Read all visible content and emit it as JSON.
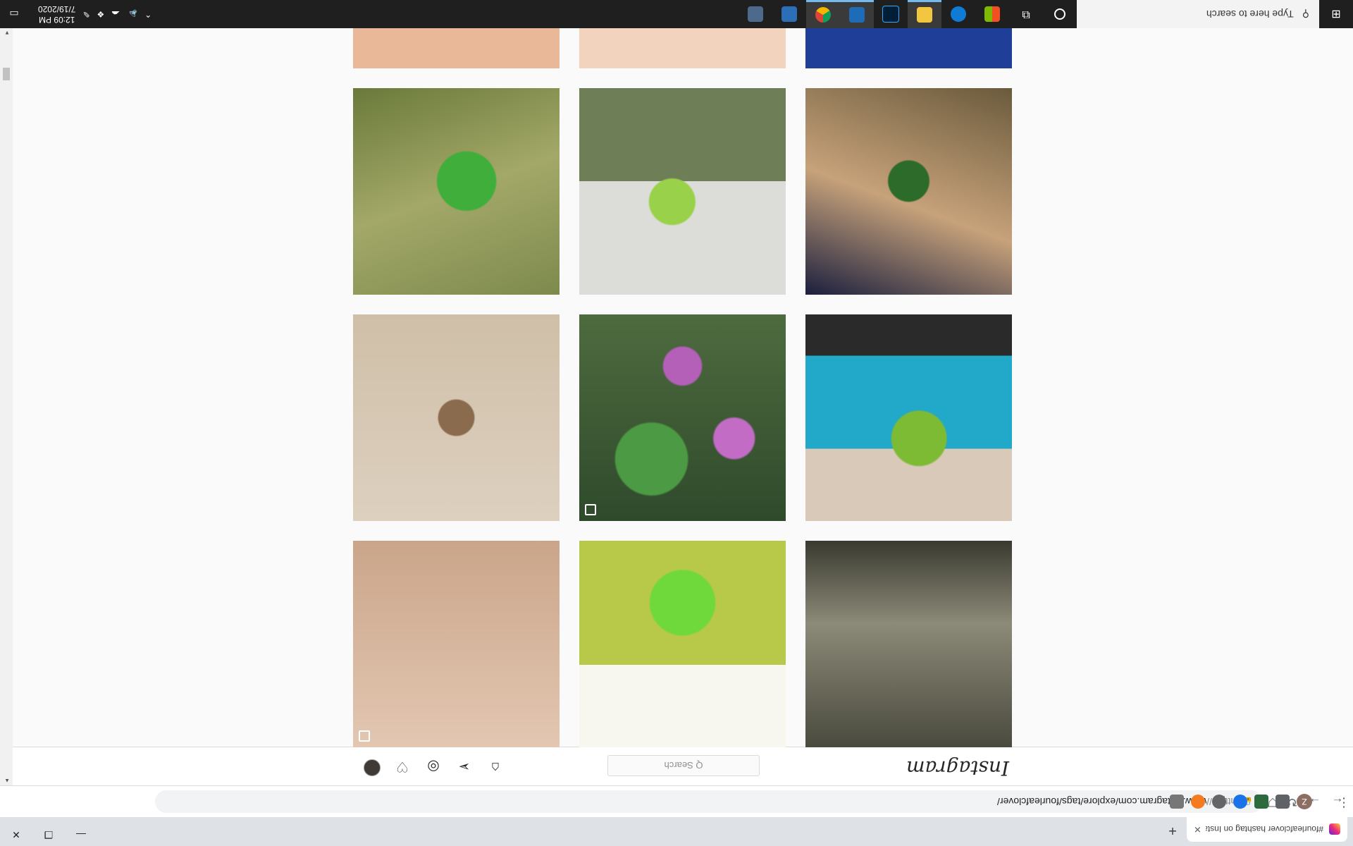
{
  "browser": {
    "tab_title": "#fourleafclover hashtag on Insta",
    "tab_close": "✕",
    "new_tab": "+",
    "url_scheme": "https://",
    "url_rest": "www.instagram.com/explore/tags/fourleafclover/",
    "profile_initial": "Z",
    "menu": "⋮",
    "window_controls": {
      "minimize": "—",
      "restore": "❐",
      "close": "✕"
    }
  },
  "instagram": {
    "logo": "Instagram",
    "search_placeholder": "Q Search",
    "tiles": [
      {
        "id": "t1",
        "style": "t-shade"
      },
      {
        "id": "t2",
        "style": "t-grass"
      },
      {
        "id": "t3",
        "style": "t-keys",
        "multi": true
      },
      {
        "id": "t4",
        "style": "t-pot"
      },
      {
        "id": "t5",
        "style": "t-daisy",
        "multi": true
      },
      {
        "id": "t6",
        "style": "t-sketch"
      },
      {
        "id": "t7",
        "style": "t-finger"
      },
      {
        "id": "t8",
        "style": "t-wall"
      },
      {
        "id": "t9",
        "style": "t-hand"
      },
      {
        "id": "t10",
        "style": "t-woman"
      },
      {
        "id": "t11",
        "style": "t-bracelet"
      },
      {
        "id": "t12",
        "style": "t-tattoo"
      }
    ]
  },
  "taskbar": {
    "search_placeholder": "Type here to search",
    "time": "12:09 PM",
    "date": "7/19/2020"
  },
  "colors": {
    "taskbar": "#1f1f1f",
    "tab_strip": "#dee1e6",
    "active_indicator": "#76b9ed"
  }
}
